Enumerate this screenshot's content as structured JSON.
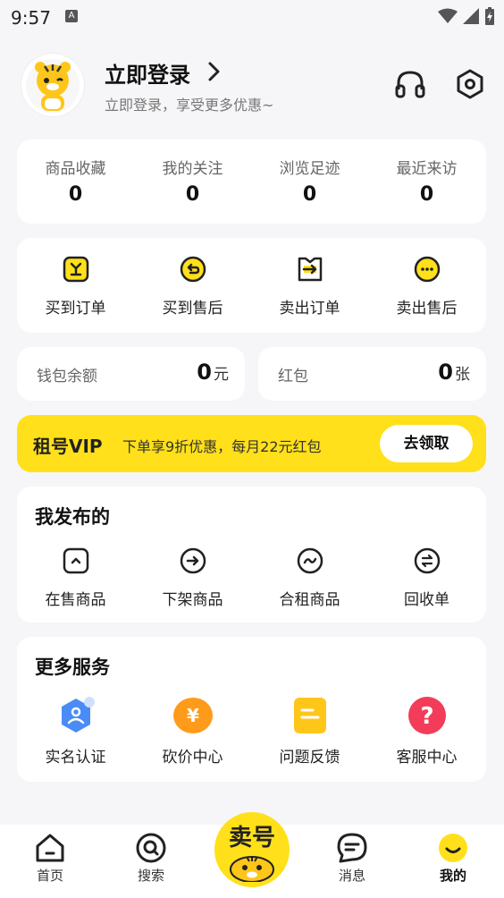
{
  "status_bar": {
    "time": "9:57",
    "a_badge": "A"
  },
  "profile": {
    "title": "立即登录",
    "subtitle": "立即登录，享受更多优惠~"
  },
  "stats": [
    {
      "label": "商品收藏",
      "value": "0"
    },
    {
      "label": "我的关注",
      "value": "0"
    },
    {
      "label": "浏览足迹",
      "value": "0"
    },
    {
      "label": "最近来访",
      "value": "0"
    }
  ],
  "orders": [
    {
      "label": "买到订单",
      "icon": "bag-icon"
    },
    {
      "label": "买到售后",
      "icon": "return-icon"
    },
    {
      "label": "卖出订单",
      "icon": "sell-order-icon"
    },
    {
      "label": "卖出售后",
      "icon": "chat-dots-icon"
    }
  ],
  "wallet": {
    "label": "钱包余额",
    "value": "0",
    "unit": "元"
  },
  "redpack": {
    "label": "红包",
    "value": "0",
    "unit": "张"
  },
  "vip": {
    "title": "租号VIP",
    "desc": "下单享9折优惠，每月22元红包",
    "button": "去领取"
  },
  "published": {
    "title": "我发布的",
    "items": [
      {
        "label": "在售商品"
      },
      {
        "label": "下架商品"
      },
      {
        "label": "合租商品"
      },
      {
        "label": "回收单"
      }
    ]
  },
  "services": {
    "title": "更多服务",
    "items": [
      {
        "label": "实名认证"
      },
      {
        "label": "砍价中心",
        "glyph": "¥"
      },
      {
        "label": "问题反馈"
      },
      {
        "label": "客服中心",
        "glyph": "?"
      }
    ]
  },
  "tabbar": {
    "home": "首页",
    "search": "搜索",
    "center": "卖号",
    "messages": "消息",
    "mine": "我的"
  },
  "colors": {
    "accent": "#ffe01a",
    "blue": "#4a8cf7",
    "orange": "#ff9b1a",
    "yellow": "#ffc61a",
    "red": "#f23c5a"
  }
}
